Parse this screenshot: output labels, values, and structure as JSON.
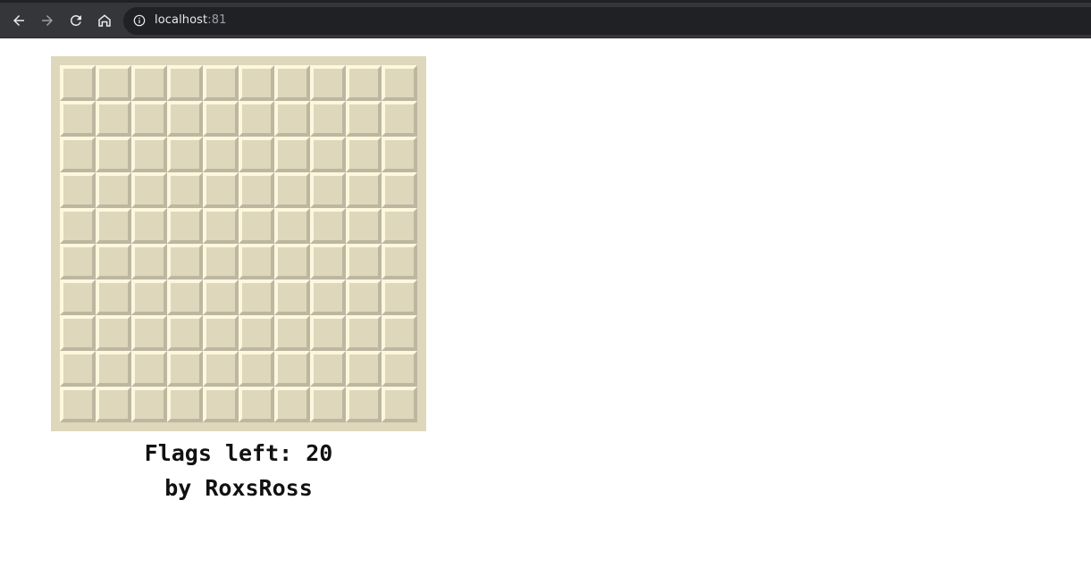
{
  "browser": {
    "nav_icons": [
      "back-arrow-icon",
      "forward-arrow-icon",
      "reload-icon",
      "home-icon"
    ],
    "url_host": "localhost",
    "url_port": ":81",
    "info_icon": "info-icon"
  },
  "game": {
    "rows": 10,
    "cols": 10,
    "flags_left_text": "Flags left: 20",
    "credit_text": "by RoxsRoss",
    "colors": {
      "board": "#ded7bb",
      "cell": "#ded7bb",
      "cell_highlight": "#fdf7de",
      "cell_shadow": "#bdb6a0"
    }
  }
}
